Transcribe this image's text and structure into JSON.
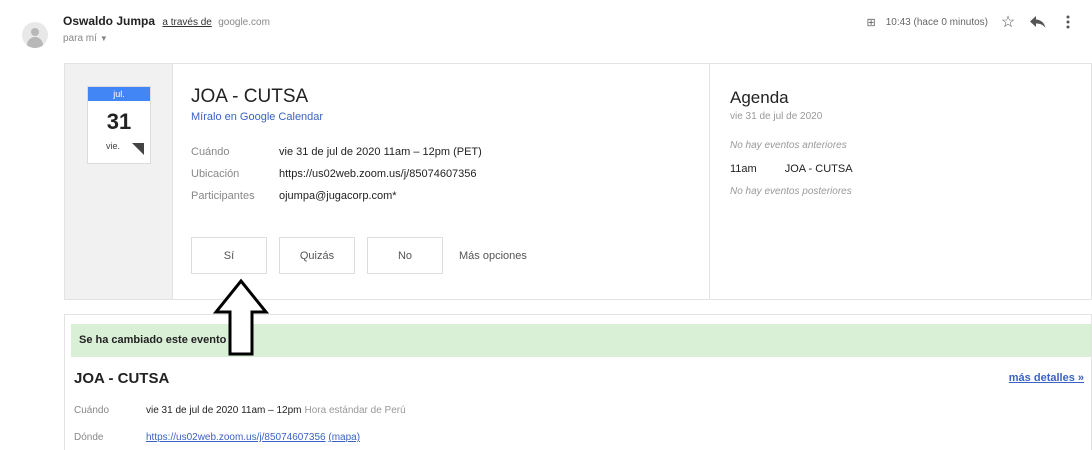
{
  "header": {
    "sender_name": "Oswaldo Jumpa",
    "via_text": "a través de",
    "via_domain": "google.com",
    "to_text": "para mí",
    "attachment_label": "⊞",
    "timestamp": "10:43 (hace 0 minutos)",
    "icons": [
      "star-icon",
      "reply-icon",
      "more-vert-icon"
    ]
  },
  "invite": {
    "date": {
      "month": "jul.",
      "day": "31",
      "weekday": "vie."
    },
    "title": "JOA - CUTSA",
    "gcal_link": "Míralo en Google Calendar",
    "details": [
      {
        "label": "Cuándo",
        "value": "vie 31 de jul de 2020 11am – 12pm (PET)"
      },
      {
        "label": "Ubicación",
        "value": "https://us02web.zoom.us/j/85074607356"
      },
      {
        "label": "Participantes",
        "value": "ojumpa@jugacorp.com*"
      }
    ],
    "rsvp": {
      "yes": "Sí",
      "maybe": "Quizás",
      "no": "No",
      "more": "Más opciones"
    }
  },
  "agenda": {
    "title": "Agenda",
    "date": "vie 31 de jul de 2020",
    "no_prev": "No hay eventos anteriores",
    "event_time": "11am",
    "event_title": "JOA - CUTSA",
    "no_next": "No hay eventos posteriores"
  },
  "changed": {
    "banner": "Se ha cambiado este evento",
    "title": "JOA - CUTSA",
    "when_label": "Cuándo",
    "when_value": "vie 31 de jul de 2020 11am – 12pm",
    "when_tz": "Hora estándar de Perú",
    "where_label": "Dónde",
    "where_link": "https://us02web.zoom.us/j/85074607356",
    "map_link": "(mapa)",
    "more_details": "más detalles »"
  }
}
